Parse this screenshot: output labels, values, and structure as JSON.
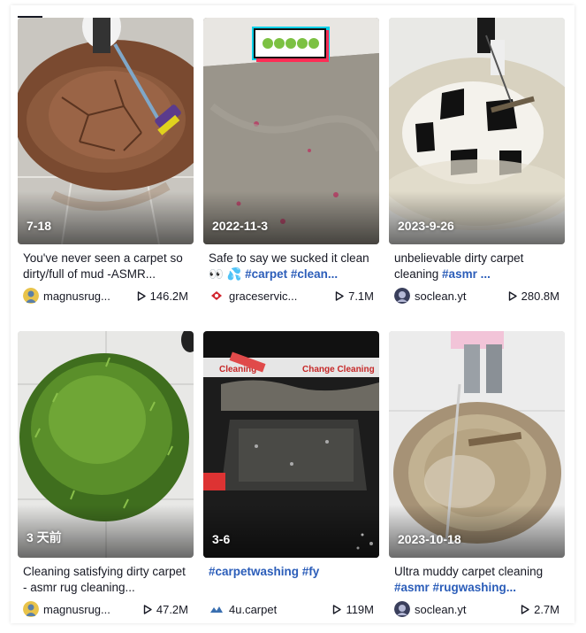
{
  "videos": [
    {
      "date": "7-18",
      "caption": "You've never seen a carpet so dirty/full of mud -ASMR...",
      "caption_tags": "",
      "author": "magnusrug...",
      "avatar_icon": "person-avatar-icon",
      "plays": "146.2M"
    },
    {
      "date": "2022-11-3",
      "caption": "Safe to say we sucked it clean 👀 💦 ",
      "caption_tags": "#carpet #clean...",
      "author": "graceservic...",
      "avatar_icon": "grace-logo-icon",
      "plays": "7.1M"
    },
    {
      "date": "2023-9-26",
      "caption": "unbelievable dirty carpet cleaning ",
      "caption_tags": "#asmr ...",
      "author": "soclean.yt",
      "avatar_icon": "soclean-avatar-icon",
      "plays": "280.8M"
    },
    {
      "date": "3 天前",
      "caption": "Cleaning satisfying dirty carpet - asmr rug cleaning...",
      "caption_tags": "",
      "author": "magnusrug...",
      "avatar_icon": "person-avatar-icon",
      "plays": "47.2M"
    },
    {
      "date": "3-6",
      "caption": "",
      "caption_tags": "#carpetwashing #fy",
      "author": "4u.carpet",
      "avatar_icon": "4u-logo-icon",
      "plays": "119M"
    },
    {
      "date": "2023-10-18",
      "caption": "Ultra muddy carpet cleaning ",
      "caption_tags": "#asmr #rugwashing...",
      "author": "soclean.yt",
      "avatar_icon": "soclean-avatar-icon",
      "plays": "2.7M"
    }
  ],
  "overlay_text": {
    "change_cleaning_left": "Cleaning",
    "change_cleaning_right": "Change Cleaning"
  },
  "icons": {
    "play": "play-icon"
  }
}
